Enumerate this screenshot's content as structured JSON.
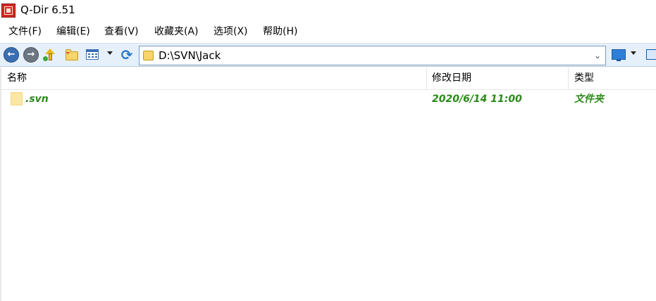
{
  "window": {
    "title": "Q-Dir 6.51"
  },
  "menu": [
    "文件(F)",
    "编辑(E)",
    "查看(V)",
    "收藏夹(A)",
    "选项(X)",
    "帮助(H)"
  ],
  "address": {
    "path": "D:\\SVN\\Jack"
  },
  "columns": {
    "name": "名称",
    "modified": "修改日期",
    "type": "类型"
  },
  "rows": [
    {
      "name": ".svn",
      "modified": "2020/6/14 11:00",
      "type": "文件夹"
    }
  ],
  "colors": {
    "row_text": "#2a8a18",
    "toolbar_bg": "#e6f0fa",
    "app_icon": "#d32a22"
  }
}
